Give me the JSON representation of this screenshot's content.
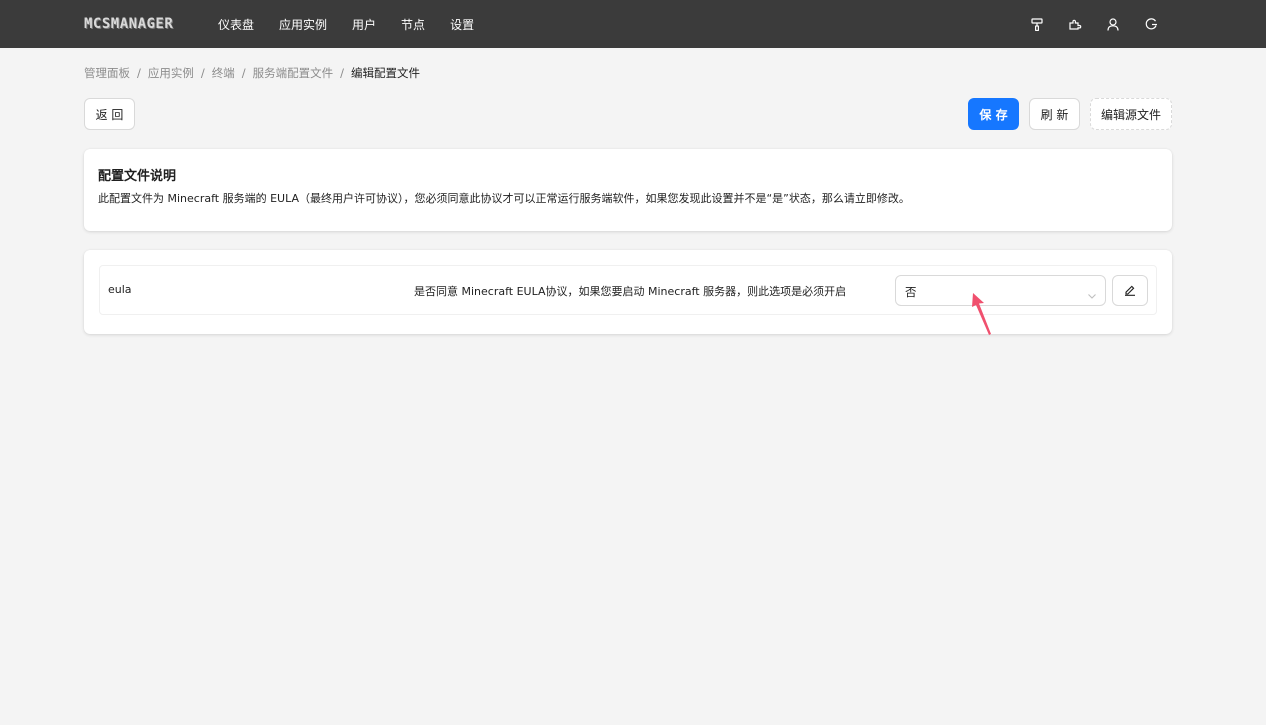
{
  "app": {
    "logo_text": "MCSMANAGER"
  },
  "nav": {
    "items": [
      {
        "label": "仪表盘"
      },
      {
        "label": "应用实例"
      },
      {
        "label": "用户"
      },
      {
        "label": "节点"
      },
      {
        "label": "设置"
      }
    ],
    "right_icons": [
      "paint-roller-icon",
      "puzzle-icon",
      "user-icon",
      "logout-icon"
    ]
  },
  "breadcrumb": {
    "items": [
      "管理面板",
      "应用实例",
      "终端",
      "服务端配置文件",
      "编辑配置文件"
    ],
    "separator": "/"
  },
  "toolbar": {
    "back_label": "返 回",
    "save_label": "保 存",
    "refresh_label": "刷 新",
    "edit_source_label": "编辑源文件"
  },
  "description_card": {
    "title": "配置文件说明",
    "text": "此配置文件为 Minecraft 服务端的 EULA（最终用户许可协议），您必须同意此协议才可以正常运行服务端软件，如果您发现此设置并不是“是”状态，那么请立即修改。"
  },
  "config": {
    "items": [
      {
        "key": "eula",
        "description": "是否同意 Minecraft EULA协议，如果您要启动 Minecraft 服务器，则此选项是必须开启",
        "value": "否"
      }
    ]
  },
  "colors": {
    "topbar": "#3b3b3b",
    "primary": "#1677ff",
    "background": "#f4f4f4",
    "annotation_arrow": "#f0506e"
  }
}
